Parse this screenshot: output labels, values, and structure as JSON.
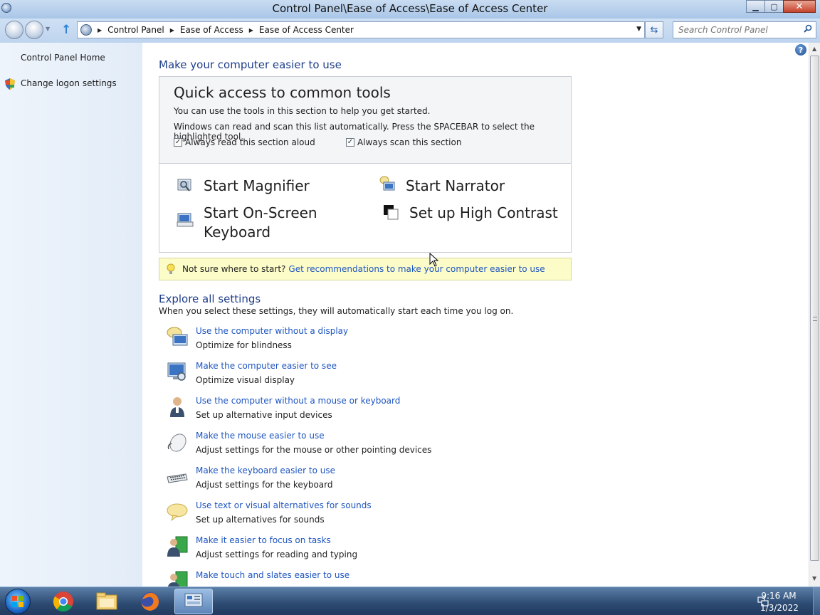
{
  "window": {
    "title": "Control Panel\\Ease of Access\\Ease of Access Center",
    "buttons": {
      "minimize": "▁",
      "maximize": "▢",
      "close": "✕"
    }
  },
  "addressbar": {
    "breadcrumbs": [
      "Control Panel",
      "Ease of Access",
      "Ease of Access Center"
    ],
    "search_placeholder": "Search Control Panel"
  },
  "sidebar": {
    "items": [
      {
        "label": "Control Panel Home",
        "icon": null
      },
      {
        "label": "Change logon settings",
        "icon": "shield-icon"
      }
    ]
  },
  "main": {
    "heading": "Make your computer easier to use",
    "quick": {
      "title": "Quick access to common tools",
      "line1": "You can use the tools in this section to help you get started.",
      "line2": "Windows can read and scan this list automatically.  Press the SPACEBAR to select the highlighted tool.",
      "check_read": "Always read this section aloud",
      "check_scan": "Always scan this section",
      "check_read_checked": true,
      "check_scan_checked": true,
      "tools": {
        "magnifier": "Start Magnifier",
        "narrator": "Start Narrator",
        "keyboard_line1": "Start On-Screen",
        "keyboard_line2": "Keyboard",
        "contrast": "Set up High Contrast"
      }
    },
    "hint": {
      "text": "Not sure where to start?",
      "link": "Get recommendations to make your computer easier to use"
    },
    "explore": {
      "heading": "Explore all settings",
      "subtext": "When you select these settings, they will automatically start each time you log on.",
      "items": [
        {
          "link": "Use the computer without a display",
          "desc": "Optimize for blindness",
          "icon": "display-speaker-icon"
        },
        {
          "link": "Make the computer easier to see",
          "desc": "Optimize visual display",
          "icon": "monitor-magnify-icon"
        },
        {
          "link": "Use the computer without a mouse or keyboard",
          "desc": "Set up alternative input devices",
          "icon": "person-speech-icon"
        },
        {
          "link": "Make the mouse easier to use",
          "desc": "Adjust settings for the mouse or other pointing devices",
          "icon": "mouse-icon"
        },
        {
          "link": "Make the keyboard easier to use",
          "desc": "Adjust settings for the keyboard",
          "icon": "keyboard-icon"
        },
        {
          "link": "Use text or visual alternatives for sounds",
          "desc": "Set up alternatives for sounds",
          "icon": "speech-bubble-icon"
        },
        {
          "link": "Make it easier to focus on tasks",
          "desc": "Adjust settings for reading and typing",
          "icon": "person-document-icon"
        },
        {
          "link": "Make touch and slates easier to use",
          "desc": "",
          "icon": "person-tablet-icon"
        }
      ]
    }
  },
  "taskbar": {
    "apps": [
      "chrome-icon",
      "file-explorer-icon",
      "firefox-icon",
      "control-panel-icon"
    ],
    "clock": {
      "time": "9:16 AM",
      "date": "1/3/2022"
    }
  },
  "colors": {
    "link": "#1e55c0",
    "heading": "#1e3e8a",
    "hint_bg": "#fcfcc9",
    "sidebar_bg": "#e9f0f9"
  }
}
